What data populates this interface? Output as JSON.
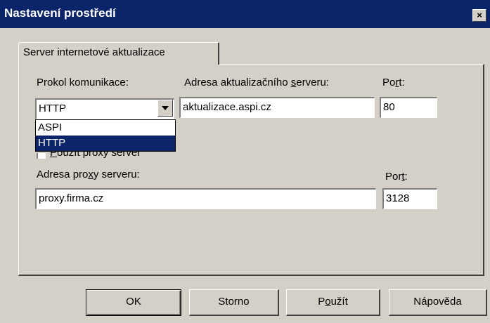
{
  "window": {
    "title": "Nastavení prostředí",
    "close_label": "×"
  },
  "tab": {
    "label": "Server internetové aktualizace"
  },
  "protocol": {
    "label_pre": "Prokol komunikace:",
    "selected": "HTTP",
    "options": [
      "ASPI",
      "HTTP"
    ]
  },
  "server": {
    "label_pre": "Adresa aktualizačního ",
    "label_accel": "s",
    "label_post": "erveru:",
    "value": "aktualizace.aspi.cz"
  },
  "port1": {
    "label_pre": "Po",
    "label_accel": "r",
    "label_post": "t:",
    "value": "80"
  },
  "proxy_checkbox": {
    "label_accel": "P",
    "label_post": "oužít proxy server"
  },
  "proxy": {
    "label_pre": "Adresa pro",
    "label_accel": "x",
    "label_post": "y serveru:",
    "value": "proxy.firma.cz"
  },
  "port2": {
    "label_pre": "Por",
    "label_accel": "t",
    "label_post": ":",
    "value": "3128"
  },
  "buttons": {
    "ok": "OK",
    "cancel": "Storno",
    "apply_pre": "P",
    "apply_accel": "o",
    "apply_post": "užít",
    "help": "Nápověda"
  }
}
